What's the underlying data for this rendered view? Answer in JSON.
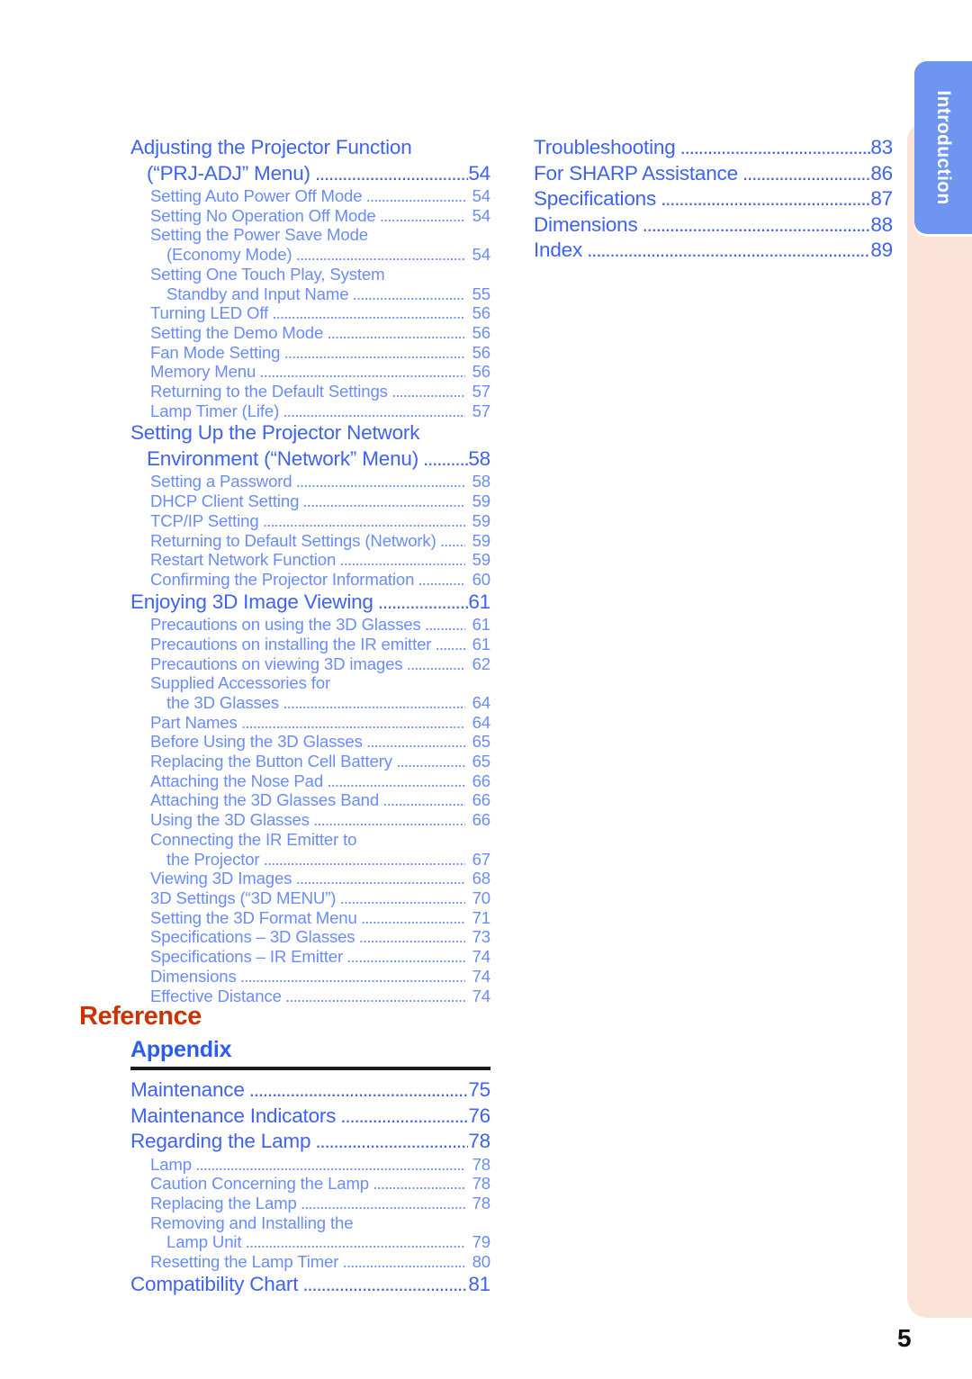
{
  "page_number": "5",
  "side_tab": {
    "active_label": "Introduction"
  },
  "colors": {
    "heading_blue": "#3f62ef",
    "sub_blue": "#6a8cf8",
    "reference_red": "#cc3300",
    "appendix_blue": "#2a5cf0",
    "tab_blue": "#6e95ef",
    "tab_peach": "#fce3d8"
  },
  "left_column": [
    {
      "level": 1,
      "title": "Adjusting the Projector Function",
      "page": "",
      "dots": false
    },
    {
      "level": 1,
      "title": "(“PRJ-ADJ” Menu)",
      "page": "54",
      "dots": true,
      "cont": true
    },
    {
      "level": 2,
      "title": "Setting Auto Power Off Mode",
      "page": "54",
      "dots": true
    },
    {
      "level": 2,
      "title": "Setting No Operation Off Mode",
      "page": "54",
      "dots": true
    },
    {
      "level": 2,
      "title": "Setting the Power Save Mode",
      "page": "",
      "dots": false
    },
    {
      "level": 2,
      "title": "(Economy Mode)",
      "page": "54",
      "dots": true,
      "cont": true
    },
    {
      "level": 2,
      "title": "Setting One Touch Play, System",
      "page": "",
      "dots": false
    },
    {
      "level": 2,
      "title": "Standby and Input Name",
      "page": "55",
      "dots": true,
      "cont": true
    },
    {
      "level": 2,
      "title": "Turning LED Off",
      "page": "56",
      "dots": true
    },
    {
      "level": 2,
      "title": "Setting the Demo Mode",
      "page": "56",
      "dots": true
    },
    {
      "level": 2,
      "title": "Fan Mode Setting",
      "page": "56",
      "dots": true
    },
    {
      "level": 2,
      "title": "Memory Menu",
      "page": "56",
      "dots": true
    },
    {
      "level": 2,
      "title": "Returning to the Default Settings",
      "page": "57",
      "dots": true
    },
    {
      "level": 2,
      "title": "Lamp Timer (Life)",
      "page": "57",
      "dots": true
    },
    {
      "level": 1,
      "title": "Setting Up the Projector Network",
      "page": "",
      "dots": false
    },
    {
      "level": 1,
      "title": "Environment (“Network” Menu)",
      "page": "58",
      "dots": true,
      "cont": true
    },
    {
      "level": 2,
      "title": "Setting a Password",
      "page": "58",
      "dots": true
    },
    {
      "level": 2,
      "title": "DHCP Client Setting",
      "page": "59",
      "dots": true
    },
    {
      "level": 2,
      "title": "TCP/IP Setting",
      "page": "59",
      "dots": true
    },
    {
      "level": 2,
      "title": "Returning to Default Settings (Network)",
      "page": "59",
      "dots": true
    },
    {
      "level": 2,
      "title": "Restart Network Function",
      "page": "59",
      "dots": true
    },
    {
      "level": 2,
      "title": "Confirming the Projector Information",
      "page": "60",
      "dots": true
    },
    {
      "level": 1,
      "title": "Enjoying 3D Image Viewing",
      "page": "61",
      "dots": true
    },
    {
      "level": 2,
      "title": "Precautions on using the 3D Glasses",
      "page": "61",
      "dots": true
    },
    {
      "level": 2,
      "title": "Precautions on installing the IR emitter",
      "page": "61",
      "dots": true
    },
    {
      "level": 2,
      "title": "Precautions on viewing 3D images",
      "page": "62",
      "dots": true
    },
    {
      "level": 2,
      "title": "Supplied Accessories for",
      "page": "",
      "dots": false
    },
    {
      "level": 2,
      "title": "the 3D Glasses",
      "page": "64",
      "dots": true,
      "cont": true
    },
    {
      "level": 2,
      "title": "Part Names",
      "page": "64",
      "dots": true
    },
    {
      "level": 2,
      "title": "Before Using the 3D Glasses",
      "page": "65",
      "dots": true
    },
    {
      "level": 2,
      "title": "Replacing the Button Cell Battery",
      "page": "65",
      "dots": true
    },
    {
      "level": 2,
      "title": "Attaching the Nose Pad",
      "page": "66",
      "dots": true
    },
    {
      "level": 2,
      "title": "Attaching the 3D Glasses Band",
      "page": "66",
      "dots": true
    },
    {
      "level": 2,
      "title": "Using the 3D Glasses",
      "page": "66",
      "dots": true
    },
    {
      "level": 2,
      "title": "Connecting the IR Emitter to",
      "page": "",
      "dots": false
    },
    {
      "level": 2,
      "title": "the Projector",
      "page": "67",
      "dots": true,
      "cont": true
    },
    {
      "level": 2,
      "title": "Viewing 3D Images",
      "page": "68",
      "dots": true
    },
    {
      "level": 2,
      "title": "3D Settings (“3D MENU”)",
      "page": "70",
      "dots": true
    },
    {
      "level": 2,
      "title": "Setting the 3D Format Menu",
      "page": "71",
      "dots": true
    },
    {
      "level": 2,
      "title": "Specifications – 3D Glasses",
      "page": "73",
      "dots": true
    },
    {
      "level": 2,
      "title": "Specifications – IR Emitter",
      "page": "74",
      "dots": true
    },
    {
      "level": 2,
      "title": "Dimensions",
      "page": "74",
      "dots": true
    },
    {
      "level": 2,
      "title": "Effective Distance",
      "page": "74",
      "dots": true
    }
  ],
  "right_column": [
    {
      "level": 1,
      "title": "Troubleshooting",
      "page": "83",
      "dots": true
    },
    {
      "level": 1,
      "title": "For SHARP Assistance",
      "page": "86",
      "dots": true
    },
    {
      "level": 1,
      "title": "Specifications",
      "page": "87",
      "dots": true
    },
    {
      "level": 1,
      "title": "Dimensions",
      "page": "88",
      "dots": true
    },
    {
      "level": 1,
      "title": "Index",
      "page": "89",
      "dots": true
    }
  ],
  "reference_section": {
    "heading": "Reference",
    "subheading": "Appendix",
    "entries": [
      {
        "level": 1,
        "title": "Maintenance",
        "page": "75",
        "dots": true
      },
      {
        "level": 1,
        "title": "Maintenance Indicators",
        "page": "76",
        "dots": true
      },
      {
        "level": 1,
        "title": "Regarding the Lamp",
        "page": "78",
        "dots": true
      },
      {
        "level": 2,
        "title": "Lamp",
        "page": "78",
        "dots": true
      },
      {
        "level": 2,
        "title": "Caution Concerning the Lamp",
        "page": "78",
        "dots": true
      },
      {
        "level": 2,
        "title": "Replacing the Lamp",
        "page": "78",
        "dots": true
      },
      {
        "level": 2,
        "title": "Removing and Installing the",
        "page": "",
        "dots": false
      },
      {
        "level": 2,
        "title": "Lamp Unit",
        "page": "79",
        "dots": true,
        "cont": true
      },
      {
        "level": 2,
        "title": "Resetting the Lamp Timer",
        "page": "80",
        "dots": true
      },
      {
        "level": 1,
        "title": "Compatibility Chart",
        "page": "81",
        "dots": true
      }
    ]
  }
}
